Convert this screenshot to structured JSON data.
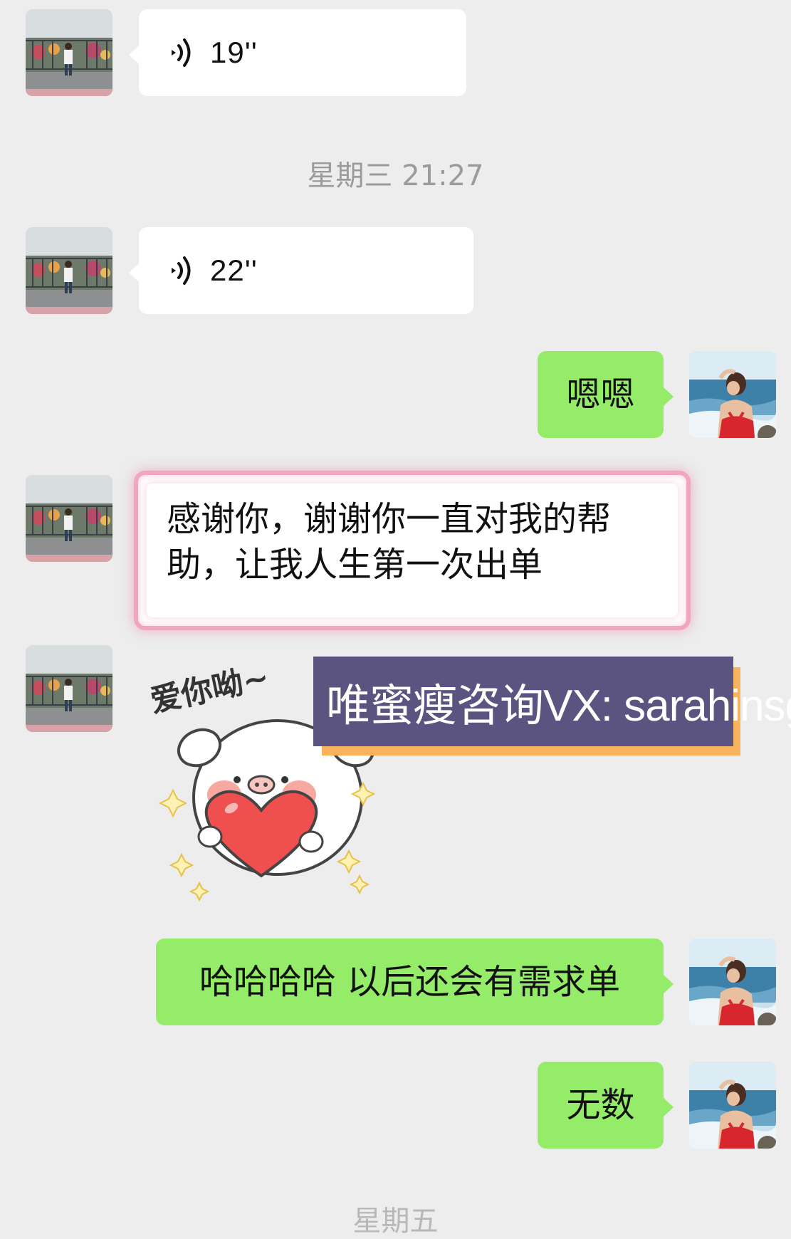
{
  "chat": {
    "messages": [
      {
        "type": "voice",
        "direction": "incoming",
        "duration": "19''"
      },
      {
        "type": "timestamp",
        "text": "星期三 21:27"
      },
      {
        "type": "voice",
        "direction": "incoming",
        "duration": "22''"
      },
      {
        "type": "text",
        "direction": "outgoing",
        "text": "嗯嗯"
      },
      {
        "type": "text",
        "direction": "incoming",
        "highlighted": true,
        "lines": [
          "感谢你，谢谢你一直对我的帮",
          "助，让我人生第一次出单"
        ]
      },
      {
        "type": "sticker",
        "direction": "incoming",
        "text": "爱你呦~"
      },
      {
        "type": "text",
        "direction": "outgoing",
        "text": "哈哈哈哈 以后还会有需求单"
      },
      {
        "type": "text",
        "direction": "outgoing",
        "text": "无数"
      }
    ],
    "bottom_peek": "星期五"
  },
  "overlay": {
    "banner_text": "唯蜜瘦咨询VX: sarahinsg"
  },
  "icons": {
    "voice": "voice-wave-icon",
    "incoming_avatar": "child-at-fence-photo",
    "outgoing_avatar": "woman-at-sea-photo"
  },
  "colors": {
    "background": "#ededed",
    "incoming_bubble": "#ffffff",
    "outgoing_bubble": "#95ec69",
    "timestamp": "#9b9b9b",
    "highlight_border": "#f2a6bd",
    "banner": "#5c5480",
    "banner_shadow": "#f9b35c"
  }
}
